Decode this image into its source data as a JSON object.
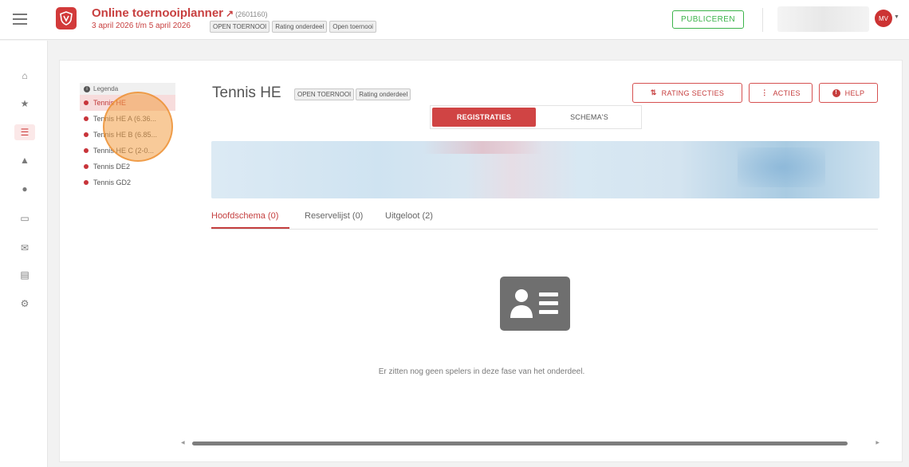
{
  "header": {
    "app_title": "Online toernooiplanner",
    "tournament_id": "(2601160)",
    "dates": "3 april 2026 t/m 5 april 2026",
    "badges": [
      "OPEN TOERNOOI",
      "Rating onderdeel",
      "Open toernooi"
    ],
    "publish_label": "PUBLICEREN",
    "user_initials": "MV"
  },
  "rail": {
    "icons": [
      "home-icon",
      "group-icon",
      "list-icon",
      "hierarchy-icon",
      "circle-icon",
      "monitor-icon",
      "mail-icon",
      "documents-icon",
      "gear-icon"
    ]
  },
  "legend": {
    "title": "Legenda",
    "items": [
      {
        "label": "Tennis HE"
      },
      {
        "label": "Tennis HE A (6.36..."
      },
      {
        "label": "Tennis HE B (6.85..."
      },
      {
        "label": "Tennis HE C (2-0..."
      },
      {
        "label": "Tennis DE2"
      },
      {
        "label": "Tennis GD2"
      }
    ]
  },
  "main": {
    "title": "Tennis HE",
    "badges": [
      "OPEN TOERNOOI",
      "Rating onderdeel"
    ],
    "buttons": {
      "rating": "RATING SECTIES",
      "actions": "ACTIES",
      "help": "HELP"
    },
    "segments": [
      "REGISTRATIES",
      "SCHEMA'S"
    ],
    "tabs": [
      "Hoofdschema (0)",
      "Reservelijst (0)",
      "Uitgeloot (2)"
    ],
    "empty_message": "Er zitten nog geen spelers in deze fase van het onderdeel."
  },
  "colors": {
    "accent": "#c84040",
    "publish": "#3bb34a"
  }
}
